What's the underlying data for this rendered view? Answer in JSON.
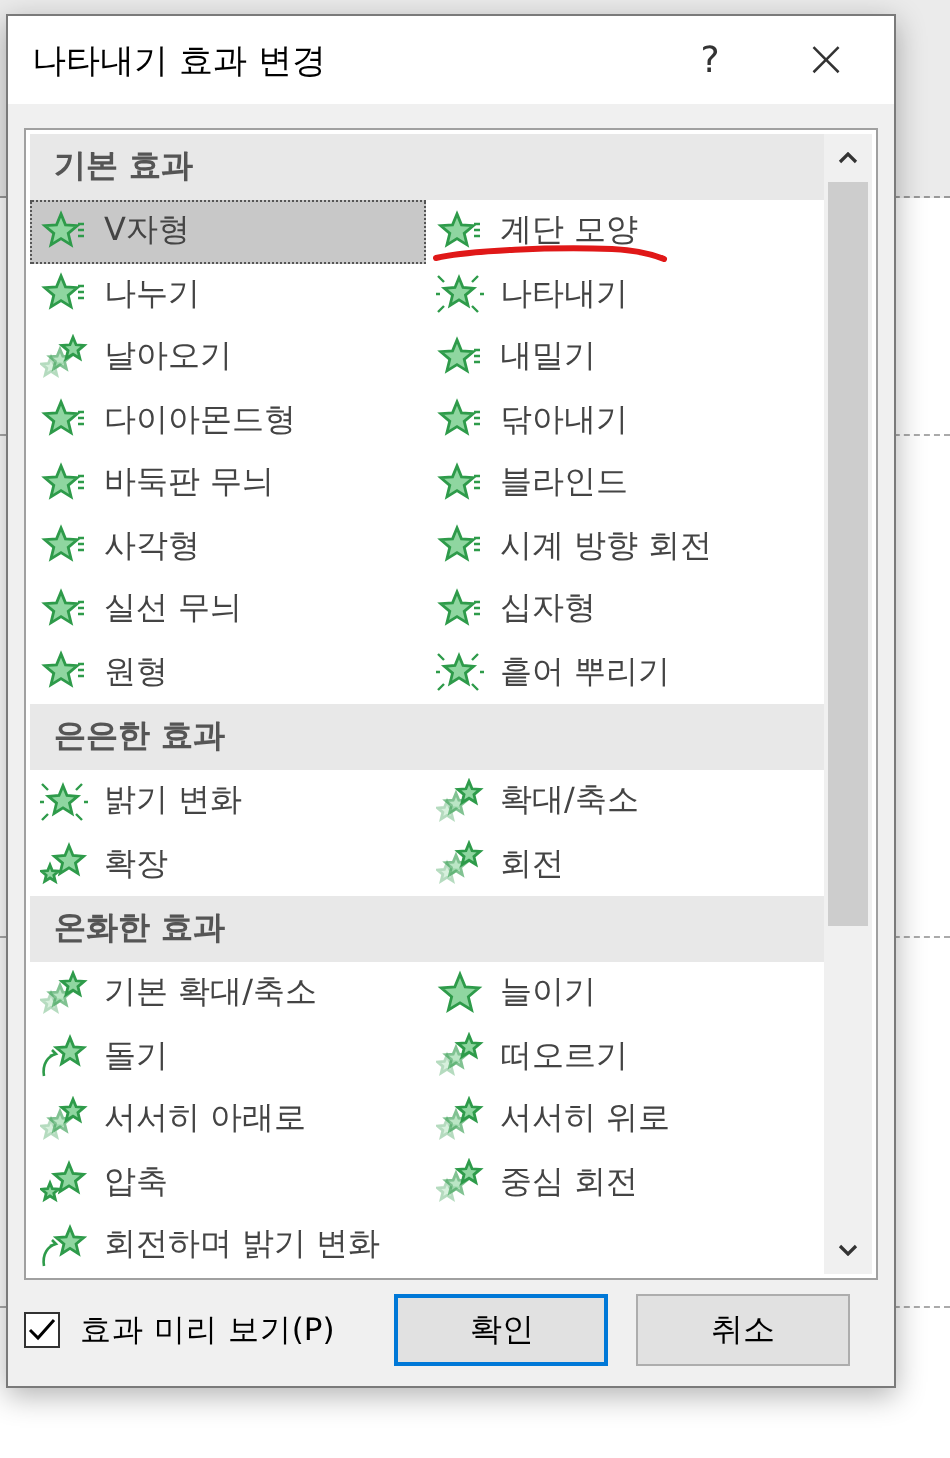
{
  "window": {
    "title": "나타내기 효과 변경",
    "help": "?",
    "close": "×"
  },
  "sections": [
    {
      "title": "기본 효과",
      "items": [
        {
          "label": "V자형",
          "kind": "star",
          "selected": true,
          "annotated": false
        },
        {
          "label": "계단 모양",
          "kind": "star",
          "selected": false,
          "annotated": true
        },
        {
          "label": "나누기",
          "kind": "star",
          "selected": false,
          "annotated": false
        },
        {
          "label": "나타내기",
          "kind": "burst",
          "selected": false,
          "annotated": false
        },
        {
          "label": "날아오기",
          "kind": "fly",
          "selected": false,
          "annotated": false
        },
        {
          "label": "내밀기",
          "kind": "star",
          "selected": false,
          "annotated": false
        },
        {
          "label": "다이아몬드형",
          "kind": "star",
          "selected": false,
          "annotated": false
        },
        {
          "label": "닦아내기",
          "kind": "star",
          "selected": false,
          "annotated": false
        },
        {
          "label": "바둑판 무늬",
          "kind": "star",
          "selected": false,
          "annotated": false
        },
        {
          "label": "블라인드",
          "kind": "star",
          "selected": false,
          "annotated": false
        },
        {
          "label": "사각형",
          "kind": "star",
          "selected": false,
          "annotated": false
        },
        {
          "label": "시계 방향 회전",
          "kind": "star",
          "selected": false,
          "annotated": false
        },
        {
          "label": "실선 무늬",
          "kind": "star",
          "selected": false,
          "annotated": false
        },
        {
          "label": "십자형",
          "kind": "star",
          "selected": false,
          "annotated": false
        },
        {
          "label": "원형",
          "kind": "star",
          "selected": false,
          "annotated": false
        },
        {
          "label": "흩어 뿌리기",
          "kind": "burst",
          "selected": false,
          "annotated": false
        }
      ]
    },
    {
      "title": "은은한 효과",
      "items": [
        {
          "label": "밝기 변화",
          "kind": "burst",
          "selected": false,
          "annotated": false
        },
        {
          "label": "확대/축소",
          "kind": "fly",
          "selected": false,
          "annotated": false
        },
        {
          "label": "확장",
          "kind": "pair",
          "selected": false,
          "annotated": false
        },
        {
          "label": "회전",
          "kind": "fly",
          "selected": false,
          "annotated": false
        }
      ]
    },
    {
      "title": "온화한 효과",
      "items": [
        {
          "label": "기본 확대/축소",
          "kind": "fly",
          "selected": false,
          "annotated": false
        },
        {
          "label": "늘이기",
          "kind": "plain",
          "selected": false,
          "annotated": false
        },
        {
          "label": "돌기",
          "kind": "spin",
          "selected": false,
          "annotated": false
        },
        {
          "label": "떠오르기",
          "kind": "fly",
          "selected": false,
          "annotated": false
        },
        {
          "label": "서서히 아래로",
          "kind": "fly",
          "selected": false,
          "annotated": false
        },
        {
          "label": "서서히 위로",
          "kind": "fly",
          "selected": false,
          "annotated": false
        },
        {
          "label": "압축",
          "kind": "pair",
          "selected": false,
          "annotated": false
        },
        {
          "label": "중심 회전",
          "kind": "fly",
          "selected": false,
          "annotated": false
        },
        {
          "label": "회전하며 밝기 변화",
          "kind": "spin",
          "selected": false,
          "annotated": false
        }
      ]
    }
  ],
  "preview": {
    "label": "효과 미리 보기(P)",
    "checked": true
  },
  "buttons": [
    {
      "label": "확인",
      "default": true
    },
    {
      "label": "취소",
      "default": false
    }
  ]
}
